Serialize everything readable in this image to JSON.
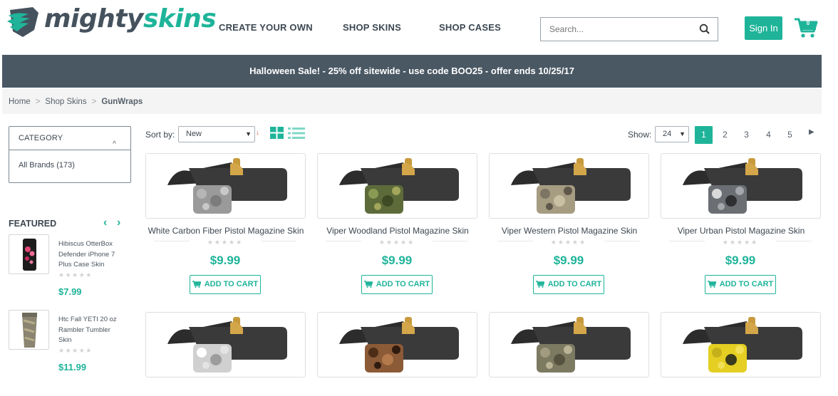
{
  "brand": {
    "part1": "mighty",
    "part2": "skins"
  },
  "nav": [
    {
      "label": "CREATE YOUR OWN"
    },
    {
      "label": "SHOP SKINS"
    },
    {
      "label": "SHOP CASES"
    }
  ],
  "search": {
    "placeholder": "Search...",
    "value": ""
  },
  "header": {
    "signin_label": "Sign In",
    "cart_count": "0"
  },
  "banner": {
    "text": "Halloween Sale! - 25% off sitewide - use code BOO25 - offer ends 10/25/17"
  },
  "breadcrumb": [
    "Home",
    "Shop Skins",
    "GunWraps"
  ],
  "sidebar": {
    "category_title": "CATEGORY",
    "categories": [
      {
        "label": "All Brands (173)"
      }
    ],
    "featured_title": "FEATURED",
    "featured": [
      {
        "name": "Hibiscus OtterBox Defender iPhone 7 Plus Case Skin",
        "stars": "★★★★★",
        "price": "$7.99"
      },
      {
        "name": "Htc Fall YETI 20 oz Rambler Tumbler Skin",
        "stars": "★★★★★",
        "price": "$11.99"
      }
    ]
  },
  "toolbar": {
    "sort_label": "Sort by:",
    "sort_value": "New",
    "show_label": "Show:",
    "show_value": "24",
    "pages": [
      "1",
      "2",
      "3",
      "4",
      "5"
    ],
    "current_page": "1"
  },
  "products": [
    {
      "name": "White Carbon Fiber Pistol Magazine Skin",
      "stars": "★★★★★",
      "price": "$9.99",
      "cta": "ADD TO CART"
    },
    {
      "name": "Viper Woodland Pistol Magazine Skin",
      "stars": "★★★★★",
      "price": "$9.99",
      "cta": "ADD TO CART"
    },
    {
      "name": "Viper Western Pistol Magazine Skin",
      "stars": "★★★★★",
      "price": "$9.99",
      "cta": "ADD TO CART"
    },
    {
      "name": "Viper Urban Pistol Magazine Skin",
      "stars": "★★★★★",
      "price": "$9.99",
      "cta": "ADD TO CART"
    }
  ],
  "colors": {
    "accent": "#1fb49a",
    "banner_bg": "#4a5864",
    "text": "#3c4650"
  }
}
